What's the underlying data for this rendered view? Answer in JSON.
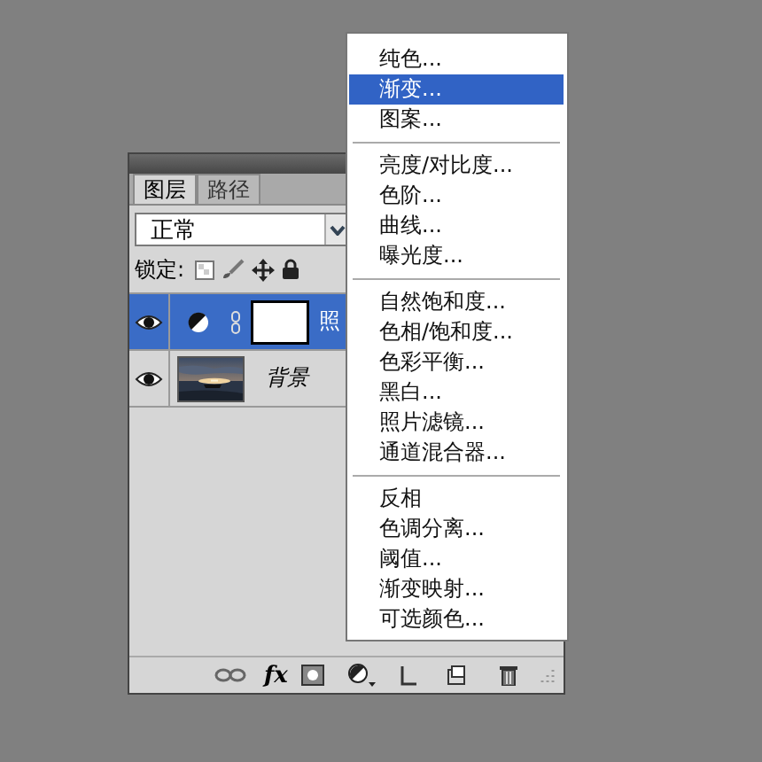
{
  "layers_panel": {
    "tabs": [
      {
        "label": "图层",
        "selected": true
      },
      {
        "label": "路径",
        "selected": false
      }
    ],
    "blend_mode": "正常",
    "lock_label": "锁定:",
    "layers": [
      {
        "kind": "adjustment",
        "name": "照",
        "selected": true,
        "visible": true
      },
      {
        "name": "背景",
        "selected": false,
        "visible": true
      }
    ],
    "toolbar_fx": "fx"
  },
  "adjustment_menu": {
    "groups": [
      [
        {
          "label": "纯色...",
          "selected": false
        },
        {
          "label": "渐变...",
          "selected": true
        },
        {
          "label": "图案...",
          "selected": false
        }
      ],
      [
        {
          "label": "亮度/对比度...",
          "selected": false
        },
        {
          "label": "色阶...",
          "selected": false
        },
        {
          "label": "曲线...",
          "selected": false
        },
        {
          "label": "曝光度...",
          "selected": false
        }
      ],
      [
        {
          "label": "自然饱和度...",
          "selected": false
        },
        {
          "label": "色相/饱和度...",
          "selected": false
        },
        {
          "label": "色彩平衡...",
          "selected": false
        },
        {
          "label": "黑白...",
          "selected": false
        },
        {
          "label": "照片滤镜...",
          "selected": false
        },
        {
          "label": "通道混合器...",
          "selected": false
        }
      ],
      [
        {
          "label": "反相",
          "selected": false
        },
        {
          "label": "色调分离...",
          "selected": false
        },
        {
          "label": "阈值...",
          "selected": false
        },
        {
          "label": "渐变映射...",
          "selected": false
        },
        {
          "label": "可选颜色...",
          "selected": false
        }
      ]
    ]
  }
}
